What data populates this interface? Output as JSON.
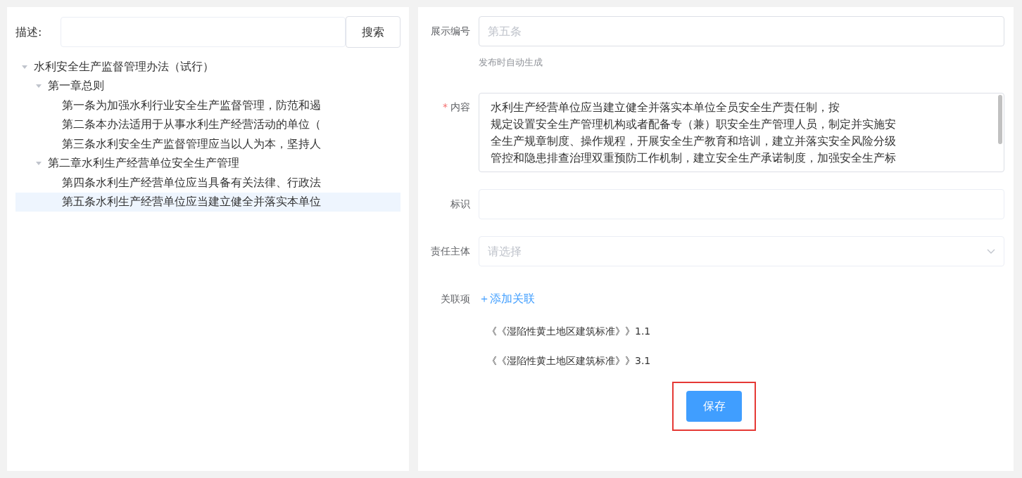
{
  "search": {
    "label": "描述:",
    "button": "搜索"
  },
  "tree": [
    {
      "label": "水利安全生产监督管理办法（试行）",
      "expanded": true,
      "selected": false,
      "children": [
        {
          "label": "第一章总则",
          "expanded": true,
          "selected": false,
          "children": [
            {
              "label": "第一条为加强水利行业安全生产监督管理，防范和遏",
              "selected": false
            },
            {
              "label": "第二条本办法适用于从事水利生产经营活动的单位（",
              "selected": false
            },
            {
              "label": "第三条水利安全生产监督管理应当以人为本，坚持人",
              "selected": false
            }
          ]
        },
        {
          "label": "第二章水利生产经营单位安全生产管理",
          "expanded": true,
          "selected": false,
          "children": [
            {
              "label": "第四条水利生产经营单位应当具备有关法律、行政法",
              "selected": false
            },
            {
              "label": "第五条水利生产经营单位应当建立健全并落实本单位",
              "selected": true
            }
          ]
        }
      ]
    }
  ],
  "form": {
    "display_number": {
      "label": "展示编号",
      "placeholder": "第五条",
      "hint": "发布时自动生成"
    },
    "content": {
      "label": "内容",
      "required_mark": "*",
      "value_lines": [
        "水利生产经营单位应当建立健全并落实本单位全员安全生产责任制，按",
        "规定设置安全生产管理机构或者配备专（兼）职安全生产管理人员，制定并实施安",
        "全生产规章制度、操作规程，开展安全生产教育和培训，建立并落实安全风险分级",
        "管控和隐患排查治理双重预防工作机制，建立安全生产承诺制度，加强安全生产标"
      ]
    },
    "identifier": {
      "label": "标识"
    },
    "responsible_subject": {
      "label": "责任主体",
      "placeholder": "请选择"
    },
    "related": {
      "label": "关联项",
      "add_link": "＋添加关联",
      "items": [
        "《《湿陷性黄土地区建筑标准》》1.1",
        "《《湿陷性黄土地区建筑标准》》3.1"
      ]
    },
    "save_button": "保存"
  }
}
